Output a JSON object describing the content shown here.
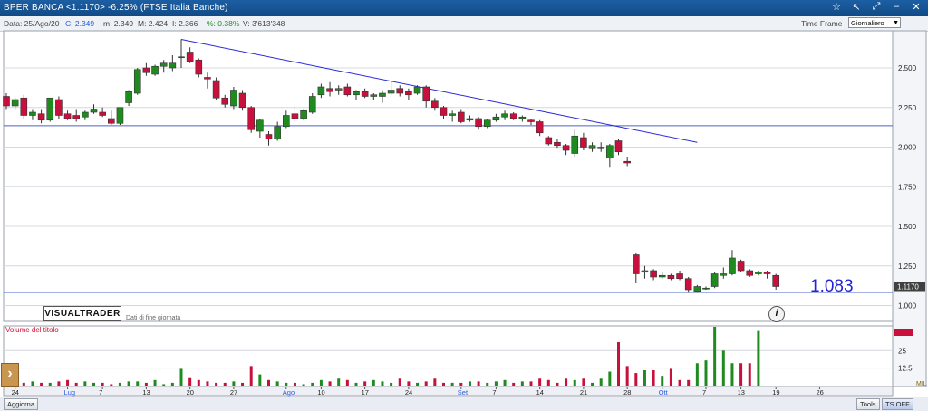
{
  "window": {
    "title": "BPER BANCA <1.1170> -6.25% (FTSE Italia Banche)"
  },
  "info": {
    "date": "Data: 25/Ago/20",
    "close": "C: 2.349",
    "low": "m: 2.349",
    "high": "M: 2.424",
    "open": "I: 2.366",
    "pct": "%: 0.38%",
    "volume": "V: 3'613'348",
    "timeframe_label": "Time Frame",
    "timeframe_value": "Giornaliero"
  },
  "branding": {
    "logo": "VISUALTRADER",
    "note": "Dati di fine giornata",
    "big_value": "1.083"
  },
  "volume_panel": {
    "title": "Volume del titolo",
    "ticks": [
      "25",
      "12.5"
    ],
    "ml": "MIL"
  },
  "bottom": {
    "refresh": "Aggiorna",
    "tools": "Tools",
    "ts": "TS OFF"
  },
  "colors": {
    "up": "#1f8b1f",
    "down": "#c8103d",
    "trend": "#2a2ad6",
    "hline": "#4b63c4"
  },
  "chart_data": {
    "type": "candlestick",
    "title": "BPER BANCA",
    "price_axis": {
      "ylim": [
        1.0,
        2.75
      ],
      "ticks": [
        1.0,
        1.25,
        1.5,
        1.75,
        2.0,
        2.25,
        2.5
      ],
      "last_label": "1.1170"
    },
    "x_ticks": [
      "24",
      "Lug",
      "7",
      "13",
      "20",
      "27",
      "Ago",
      "10",
      "17",
      "24",
      "Set",
      "7",
      "14",
      "21",
      "28",
      "Ott",
      "7",
      "13",
      "19",
      "26"
    ],
    "candles": [
      {
        "o": 2.32,
        "h": 2.34,
        "l": 2.24,
        "c": 2.26
      },
      {
        "o": 2.26,
        "h": 2.31,
        "l": 2.24,
        "c": 2.3
      },
      {
        "o": 2.31,
        "h": 2.33,
        "l": 2.18,
        "c": 2.2
      },
      {
        "o": 2.2,
        "h": 2.24,
        "l": 2.17,
        "c": 2.22
      },
      {
        "o": 2.21,
        "h": 2.24,
        "l": 2.15,
        "c": 2.17
      },
      {
        "o": 2.17,
        "h": 2.31,
        "l": 2.16,
        "c": 2.31
      },
      {
        "o": 2.3,
        "h": 2.32,
        "l": 2.18,
        "c": 2.2
      },
      {
        "o": 2.21,
        "h": 2.23,
        "l": 2.17,
        "c": 2.18
      },
      {
        "o": 2.2,
        "h": 2.24,
        "l": 2.16,
        "c": 2.18
      },
      {
        "o": 2.19,
        "h": 2.23,
        "l": 2.17,
        "c": 2.22
      },
      {
        "o": 2.22,
        "h": 2.27,
        "l": 2.21,
        "c": 2.24
      },
      {
        "o": 2.22,
        "h": 2.25,
        "l": 2.19,
        "c": 2.2
      },
      {
        "o": 2.18,
        "h": 2.23,
        "l": 2.14,
        "c": 2.15
      },
      {
        "o": 2.15,
        "h": 2.25,
        "l": 2.14,
        "c": 2.25
      },
      {
        "o": 2.28,
        "h": 2.36,
        "l": 2.26,
        "c": 2.35
      },
      {
        "o": 2.34,
        "h": 2.5,
        "l": 2.33,
        "c": 2.49
      },
      {
        "o": 2.5,
        "h": 2.53,
        "l": 2.45,
        "c": 2.47
      },
      {
        "o": 2.46,
        "h": 2.52,
        "l": 2.45,
        "c": 2.51
      },
      {
        "o": 2.51,
        "h": 2.55,
        "l": 2.47,
        "c": 2.53
      },
      {
        "o": 2.5,
        "h": 2.58,
        "l": 2.48,
        "c": 2.53
      },
      {
        "o": 2.57,
        "h": 2.68,
        "l": 2.5,
        "c": 2.57
      },
      {
        "o": 2.6,
        "h": 2.63,
        "l": 2.53,
        "c": 2.54
      },
      {
        "o": 2.55,
        "h": 2.56,
        "l": 2.44,
        "c": 2.46
      },
      {
        "o": 2.44,
        "h": 2.47,
        "l": 2.37,
        "c": 2.43
      },
      {
        "o": 2.42,
        "h": 2.44,
        "l": 2.3,
        "c": 2.31
      },
      {
        "o": 2.31,
        "h": 2.33,
        "l": 2.25,
        "c": 2.27
      },
      {
        "o": 2.26,
        "h": 2.38,
        "l": 2.24,
        "c": 2.36
      },
      {
        "o": 2.34,
        "h": 2.36,
        "l": 2.23,
        "c": 2.25
      },
      {
        "o": 2.25,
        "h": 2.26,
        "l": 2.09,
        "c": 2.11
      },
      {
        "o": 2.1,
        "h": 2.18,
        "l": 2.06,
        "c": 2.17
      },
      {
        "o": 2.08,
        "h": 2.1,
        "l": 2.01,
        "c": 2.05
      },
      {
        "o": 2.05,
        "h": 2.16,
        "l": 2.04,
        "c": 2.13
      },
      {
        "o": 2.13,
        "h": 2.23,
        "l": 2.12,
        "c": 2.2
      },
      {
        "o": 2.21,
        "h": 2.26,
        "l": 2.16,
        "c": 2.18
      },
      {
        "o": 2.18,
        "h": 2.24,
        "l": 2.17,
        "c": 2.23
      },
      {
        "o": 2.22,
        "h": 2.34,
        "l": 2.21,
        "c": 2.32
      },
      {
        "o": 2.33,
        "h": 2.4,
        "l": 2.31,
        "c": 2.38
      },
      {
        "o": 2.37,
        "h": 2.41,
        "l": 2.32,
        "c": 2.35
      },
      {
        "o": 2.36,
        "h": 2.39,
        "l": 2.33,
        "c": 2.37
      },
      {
        "o": 2.38,
        "h": 2.4,
        "l": 2.32,
        "c": 2.33
      },
      {
        "o": 2.33,
        "h": 2.36,
        "l": 2.3,
        "c": 2.35
      },
      {
        "o": 2.35,
        "h": 2.37,
        "l": 2.31,
        "c": 2.32
      },
      {
        "o": 2.32,
        "h": 2.34,
        "l": 2.3,
        "c": 2.33
      },
      {
        "o": 2.32,
        "h": 2.36,
        "l": 2.28,
        "c": 2.34
      },
      {
        "o": 2.34,
        "h": 2.42,
        "l": 2.33,
        "c": 2.36
      },
      {
        "o": 2.37,
        "h": 2.39,
        "l": 2.32,
        "c": 2.34
      },
      {
        "o": 2.35,
        "h": 2.37,
        "l": 2.3,
        "c": 2.33
      },
      {
        "o": 2.34,
        "h": 2.39,
        "l": 2.33,
        "c": 2.38
      },
      {
        "o": 2.38,
        "h": 2.39,
        "l": 2.25,
        "c": 2.29
      },
      {
        "o": 2.29,
        "h": 2.31,
        "l": 2.23,
        "c": 2.25
      },
      {
        "o": 2.25,
        "h": 2.26,
        "l": 2.18,
        "c": 2.2
      },
      {
        "o": 2.2,
        "h": 2.23,
        "l": 2.16,
        "c": 2.21
      },
      {
        "o": 2.22,
        "h": 2.24,
        "l": 2.15,
        "c": 2.16
      },
      {
        "o": 2.17,
        "h": 2.2,
        "l": 2.16,
        "c": 2.18
      },
      {
        "o": 2.18,
        "h": 2.19,
        "l": 2.11,
        "c": 2.13
      },
      {
        "o": 2.13,
        "h": 2.18,
        "l": 2.12,
        "c": 2.17
      },
      {
        "o": 2.17,
        "h": 2.21,
        "l": 2.16,
        "c": 2.19
      },
      {
        "o": 2.19,
        "h": 2.23,
        "l": 2.17,
        "c": 2.21
      },
      {
        "o": 2.21,
        "h": 2.22,
        "l": 2.17,
        "c": 2.18
      },
      {
        "o": 2.18,
        "h": 2.2,
        "l": 2.16,
        "c": 2.19
      },
      {
        "o": 2.17,
        "h": 2.18,
        "l": 2.14,
        "c": 2.16
      },
      {
        "o": 2.16,
        "h": 2.17,
        "l": 2.07,
        "c": 2.09
      },
      {
        "o": 2.06,
        "h": 2.07,
        "l": 2.01,
        "c": 2.02
      },
      {
        "o": 2.03,
        "h": 2.05,
        "l": 1.99,
        "c": 2.01
      },
      {
        "o": 2.01,
        "h": 2.02,
        "l": 1.95,
        "c": 1.98
      },
      {
        "o": 1.96,
        "h": 2.11,
        "l": 1.94,
        "c": 2.07
      },
      {
        "o": 2.06,
        "h": 2.09,
        "l": 1.98,
        "c": 2.0
      },
      {
        "o": 1.99,
        "h": 2.03,
        "l": 1.97,
        "c": 2.01
      },
      {
        "o": 1.99,
        "h": 2.03,
        "l": 1.97,
        "c": 2.0
      },
      {
        "o": 1.93,
        "h": 2.02,
        "l": 1.87,
        "c": 2.01
      },
      {
        "o": 2.04,
        "h": 2.05,
        "l": 1.95,
        "c": 1.97
      },
      {
        "o": 1.91,
        "h": 1.94,
        "l": 1.88,
        "c": 1.9
      },
      {
        "o": 1.32,
        "h": 1.33,
        "l": 1.14,
        "c": 1.2
      },
      {
        "o": 1.21,
        "h": 1.25,
        "l": 1.17,
        "c": 1.22
      },
      {
        "o": 1.22,
        "h": 1.23,
        "l": 1.16,
        "c": 1.18
      },
      {
        "o": 1.18,
        "h": 1.21,
        "l": 1.17,
        "c": 1.19
      },
      {
        "o": 1.19,
        "h": 1.2,
        "l": 1.16,
        "c": 1.17
      },
      {
        "o": 1.2,
        "h": 1.22,
        "l": 1.16,
        "c": 1.17
      },
      {
        "o": 1.17,
        "h": 1.18,
        "l": 1.08,
        "c": 1.1
      },
      {
        "o": 1.09,
        "h": 1.13,
        "l": 1.08,
        "c": 1.12
      },
      {
        "o": 1.11,
        "h": 1.12,
        "l": 1.1,
        "c": 1.11
      },
      {
        "o": 1.12,
        "h": 1.21,
        "l": 1.11,
        "c": 1.2
      },
      {
        "o": 1.19,
        "h": 1.24,
        "l": 1.17,
        "c": 1.2
      },
      {
        "o": 1.2,
        "h": 1.35,
        "l": 1.19,
        "c": 1.3
      },
      {
        "o": 1.28,
        "h": 1.29,
        "l": 1.21,
        "c": 1.22
      },
      {
        "o": 1.22,
        "h": 1.23,
        "l": 1.18,
        "c": 1.19
      },
      {
        "o": 1.2,
        "h": 1.22,
        "l": 1.19,
        "c": 1.21
      },
      {
        "o": 1.21,
        "h": 1.22,
        "l": 1.17,
        "c": 1.2
      },
      {
        "o": 1.19,
        "h": 1.2,
        "l": 1.1,
        "c": 1.12
      }
    ],
    "volumes": [
      4,
      1,
      2,
      3,
      2,
      2,
      3,
      4,
      2,
      3,
      2,
      2,
      1,
      2,
      3,
      3,
      2,
      4,
      1,
      2,
      12,
      6,
      4,
      3,
      2,
      2,
      3,
      2,
      14,
      8,
      4,
      3,
      2,
      2,
      1,
      2,
      4,
      3,
      5,
      4,
      2,
      3,
      4,
      3,
      2,
      5,
      3,
      2,
      3,
      5,
      2,
      2,
      2,
      3,
      3,
      2,
      3,
      4,
      2,
      3,
      3,
      5,
      4,
      2,
      5,
      4,
      5,
      2,
      5,
      10,
      31,
      14,
      9,
      11,
      11,
      7,
      12,
      4,
      4,
      16,
      18,
      42,
      25,
      16,
      16,
      16,
      39
    ],
    "volume_ylim": [
      0,
      42
    ],
    "trendline": [
      {
        "i": 20,
        "v": 2.68
      },
      {
        "i": 79,
        "v": 2.03
      }
    ],
    "hlines": [
      2.135,
      1.083
    ]
  }
}
